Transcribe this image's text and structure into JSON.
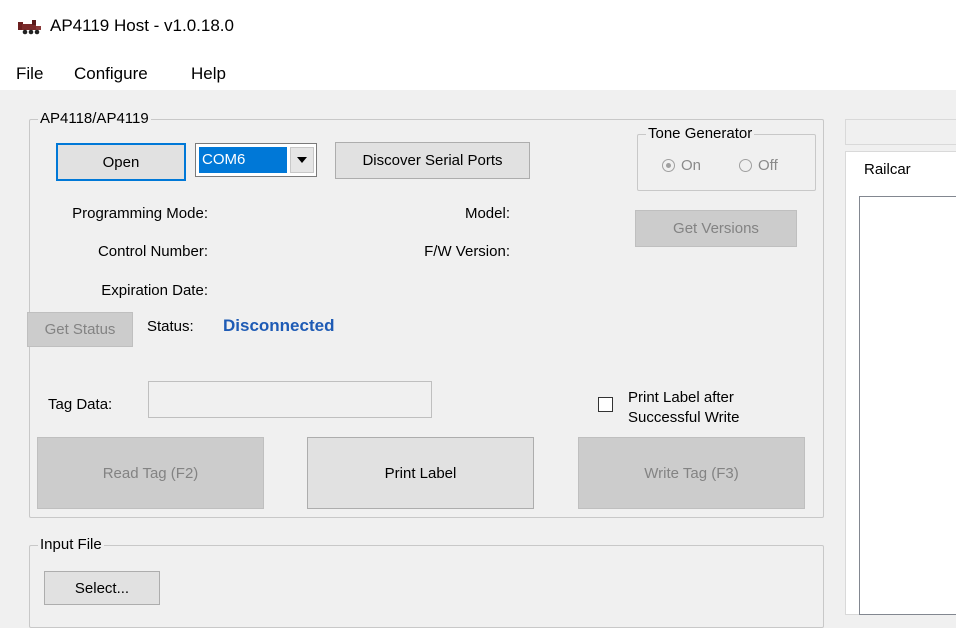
{
  "window": {
    "title": "AP4119 Host - v1.0.18.0"
  },
  "menu": {
    "file": "File",
    "configure": "Configure",
    "help": "Help"
  },
  "device_group": {
    "legend": "AP4118/AP4119",
    "open_button": "Open",
    "port_combo_value": "COM6",
    "discover_button": "Discover Serial Ports",
    "programming_mode_label": "Programming Mode:",
    "control_number_label": "Control Number:",
    "expiration_date_label": "Expiration Date:",
    "model_label": "Model:",
    "fw_version_label": "F/W Version:",
    "get_status_button": "Get Status",
    "status_label": "Status:",
    "status_value": "Disconnected",
    "status_color": "#1e5bb5",
    "tag_data_label": "Tag Data:",
    "tag_data_value": "",
    "print_after_write_line1": "Print Label after",
    "print_after_write_line2": "Successful Write",
    "print_after_write_checked": false,
    "read_tag_button": "Read Tag (F2)",
    "print_label_button": "Print Label",
    "write_tag_button": "Write Tag (F3)"
  },
  "tone_generator": {
    "legend": "Tone Generator",
    "on_label": "On",
    "off_label": "Off",
    "selected": "On",
    "get_versions_button": "Get Versions"
  },
  "input_file": {
    "legend": "Input File",
    "select_button": "Select..."
  },
  "right_tabs": {
    "active_tab": "Railcar"
  },
  "colors": {
    "accent": "#0078d7",
    "window_bg": "#f0f0f0",
    "disabled_text": "#838383"
  },
  "icons": {
    "app": "locomotive-icon",
    "dropdown": "chevron-down-icon"
  }
}
